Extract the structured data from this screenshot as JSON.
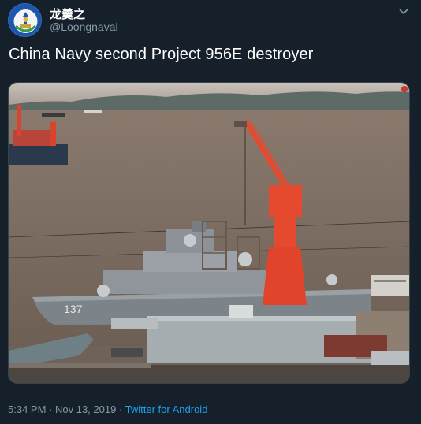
{
  "author": {
    "display_name": "龙羹之",
    "handle": "@Loongnaval",
    "avatar_icon": "navy-emblem-icon"
  },
  "menu": {
    "icon": "chevron-down-icon"
  },
  "tweet": {
    "text": "China Navy second Project 956E destroyer",
    "media": {
      "description_hull_number": "137"
    }
  },
  "meta": {
    "time": "5:34 PM",
    "separator1": " · ",
    "date": "Nov 13, 2019",
    "separator2": " · ",
    "source": "Twitter for Android"
  },
  "colors": {
    "background": "#15202b",
    "secondary_text": "#8899a6",
    "link": "#1da1f2",
    "crane": "#e64a2e"
  }
}
